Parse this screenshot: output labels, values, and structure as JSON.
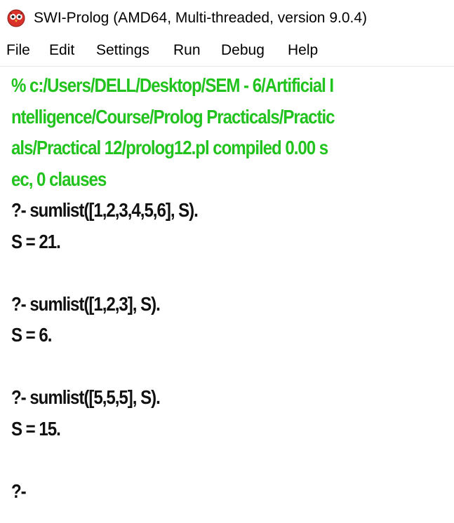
{
  "window": {
    "title": "SWI-Prolog (AMD64, Multi-threaded, version 9.0.4)"
  },
  "menu": {
    "items": [
      {
        "id": "file",
        "label": "File"
      },
      {
        "id": "edit",
        "label": "Edit"
      },
      {
        "id": "settings",
        "label": "Settings"
      },
      {
        "id": "run",
        "label": "Run"
      },
      {
        "id": "debug",
        "label": "Debug"
      },
      {
        "id": "help",
        "label": "Help"
      }
    ]
  },
  "console": {
    "compile_lines": [
      "% c:/Users/DELL/Desktop/SEM - 6/Artificial I",
      "ntelligence/Course/Prolog Practicals/Practic",
      "als/Practical 12/prolog12.pl compiled 0.00 s",
      "ec, 0 clauses"
    ],
    "queries": [
      {
        "query": "?- sumlist([1,2,3,4,5,6], S).",
        "result": "S = 21."
      },
      {
        "query": "?- sumlist([1,2,3], S).",
        "result": "S = 6."
      },
      {
        "query": "?- sumlist([5,5,5], S).",
        "result": "S = 15."
      }
    ],
    "prompt": "?-"
  },
  "colors": {
    "compile_text": "#22c31e",
    "normal_text": "#111111",
    "background": "#ffffff"
  },
  "icons": {
    "app_icon": "owl-icon"
  }
}
